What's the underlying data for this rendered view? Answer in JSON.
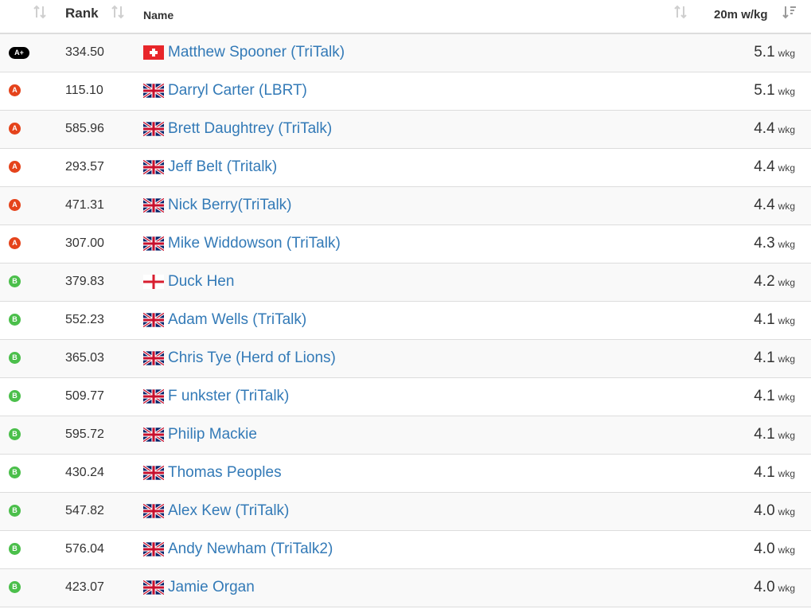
{
  "header": {
    "rank_label": "Rank",
    "name_label": "Name",
    "wkg_label": "20m w/kg"
  },
  "colors": {
    "link": "#337ab7",
    "cat_A_plus": "#000000",
    "cat_A": "#e5431b",
    "cat_B": "#4bbf4b"
  },
  "unit": "wkg",
  "rows": [
    {
      "cat": "A+",
      "rank": "334.50",
      "flag": "switzerland-flag",
      "name": "Matthew Spooner (TriTalk)",
      "wkg": "5.1"
    },
    {
      "cat": "A",
      "rank": "115.10",
      "flag": "uk-flag",
      "name": "Darryl Carter (LBRT)",
      "wkg": "5.1"
    },
    {
      "cat": "A",
      "rank": "585.96",
      "flag": "uk-flag",
      "name": "Brett Daughtrey (TriTalk)",
      "wkg": "4.4"
    },
    {
      "cat": "A",
      "rank": "293.57",
      "flag": "uk-flag",
      "name": "Jeff Belt (Tritalk)",
      "wkg": "4.4"
    },
    {
      "cat": "A",
      "rank": "471.31",
      "flag": "uk-flag",
      "name": "Nick Berry(TriTalk)",
      "wkg": "4.4"
    },
    {
      "cat": "A",
      "rank": "307.00",
      "flag": "uk-flag",
      "name": "Mike Widdowson (TriTalk)",
      "wkg": "4.3"
    },
    {
      "cat": "B",
      "rank": "379.83",
      "flag": "england-flag",
      "name": "Duck Hen",
      "wkg": "4.2"
    },
    {
      "cat": "B",
      "rank": "552.23",
      "flag": "uk-flag",
      "name": "Adam Wells (TriTalk)",
      "wkg": "4.1"
    },
    {
      "cat": "B",
      "rank": "365.03",
      "flag": "uk-flag",
      "name": "Chris Tye (Herd of Lions)",
      "wkg": "4.1"
    },
    {
      "cat": "B",
      "rank": "509.77",
      "flag": "uk-flag",
      "name": "F unkster (TriTalk)",
      "wkg": "4.1"
    },
    {
      "cat": "B",
      "rank": "595.72",
      "flag": "uk-flag",
      "name": "Philip Mackie",
      "wkg": "4.1"
    },
    {
      "cat": "B",
      "rank": "430.24",
      "flag": "uk-flag",
      "name": "Thomas Peoples",
      "wkg": "4.1"
    },
    {
      "cat": "B",
      "rank": "547.82",
      "flag": "uk-flag",
      "name": "Alex Kew (TriTalk)",
      "wkg": "4.0"
    },
    {
      "cat": "B",
      "rank": "576.04",
      "flag": "uk-flag",
      "name": "Andy Newham (TriTalk2)",
      "wkg": "4.0"
    },
    {
      "cat": "B",
      "rank": "423.07",
      "flag": "uk-flag",
      "name": "Jamie Organ",
      "wkg": "4.0"
    }
  ]
}
